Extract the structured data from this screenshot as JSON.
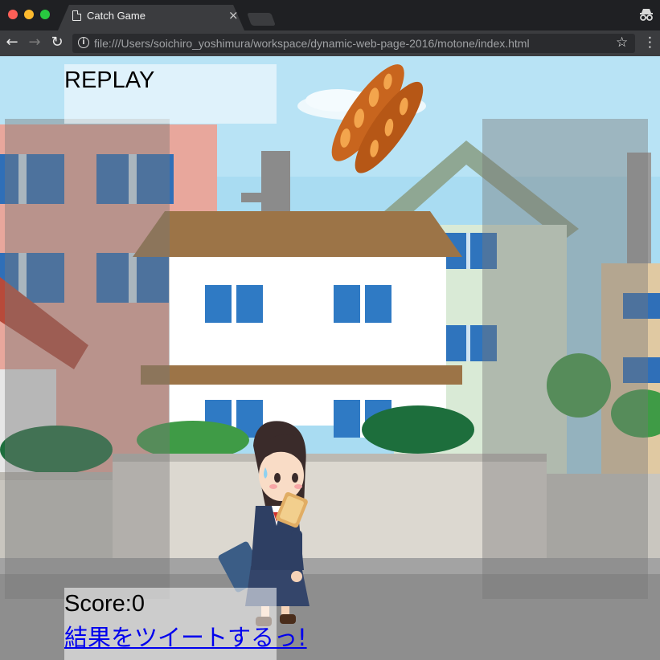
{
  "browser": {
    "tab_title": "Catch Game",
    "tab_close": "×",
    "url": "file:///Users/soichiro_yoshimura/workspace/dynamic-web-page-2016/motone/index.html"
  },
  "game": {
    "replay_label": "REPLAY",
    "score_text": "Score:0",
    "tweet_link": "結果をツイートするっ!",
    "falling_item": "baguette-bread-icon",
    "player_character": "schoolgirl-with-toast",
    "background": "residential-street-scene"
  },
  "colors": {
    "sky": "#a9dcf2",
    "link": "#0000ee",
    "bread": "#c8651e"
  }
}
